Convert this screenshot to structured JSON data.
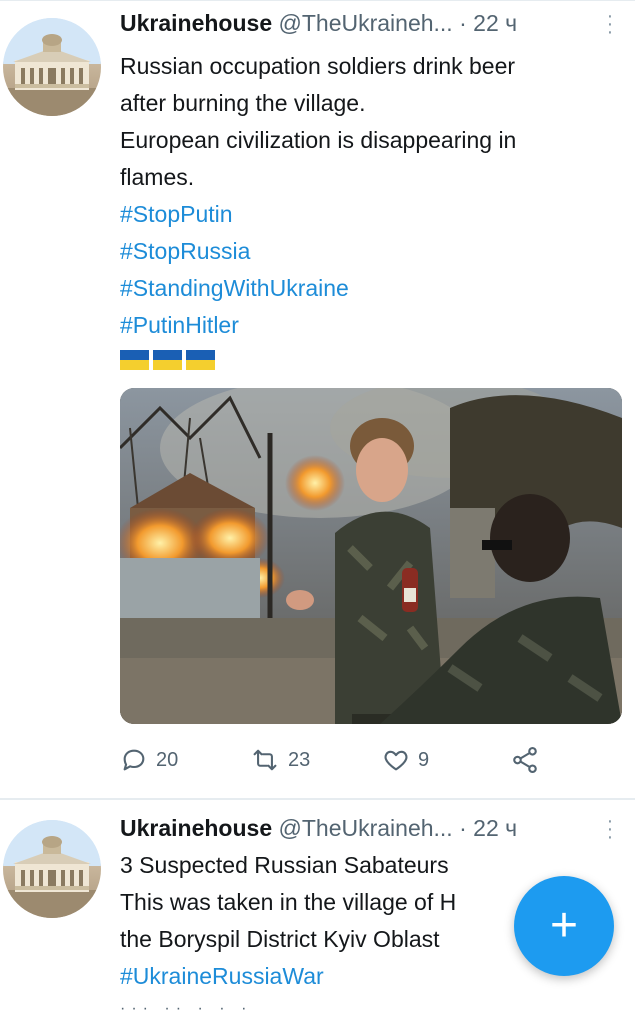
{
  "tweets": [
    {
      "author": {
        "name": "Ukrainehouse",
        "handle": "@TheUkraineh...",
        "separator": "·",
        "time": "22 ч"
      },
      "text_lines": [
        "Russian occupation soldiers drink beer",
        "after burning the village.",
        "European civilization is disappearing in",
        "flames."
      ],
      "hashtags": [
        "#StopPutin",
        "#StopRussia",
        "#StandingWithUkraine",
        "#PutinHitler"
      ],
      "flag_count": 3,
      "actions": {
        "replies": "20",
        "retweets": "23",
        "likes": "9"
      },
      "icons": {
        "reply": "reply-icon",
        "retweet": "retweet-icon",
        "like": "heart-icon",
        "share": "share-icon",
        "more": "more-icon"
      }
    },
    {
      "author": {
        "name": "Ukrainehouse",
        "handle": "@TheUkraineh...",
        "separator": "·",
        "time": "22 ч"
      },
      "text_lines": [
        "3 Suspected Russian Sabateurs",
        "This was taken in the village of H",
        "the Boryspil District Kyiv Oblast"
      ],
      "hashtags": [
        "#UkraineRussiaWar"
      ]
    }
  ],
  "fab": {
    "label": "+",
    "icon": "compose-plus-icon"
  },
  "colors": {
    "link": "#1d8cd8",
    "muted": "#536471",
    "fab": "#1d9bf0",
    "flag_blue": "#1a5fb4",
    "flag_yellow": "#f4cf2e"
  }
}
